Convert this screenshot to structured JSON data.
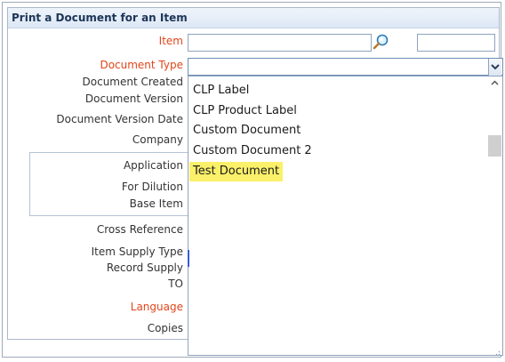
{
  "panel": {
    "title": "Print a Document for an Item"
  },
  "labels": {
    "item": "Item",
    "document_type": "Document Type",
    "document_created": "Document Created",
    "document_version": "Document Version",
    "document_version_date": "Document Version Date",
    "company": "Company",
    "application": "Application",
    "for_dilution": "For Dilution",
    "base_item": "Base Item",
    "cross_reference": "Cross Reference",
    "item_supply_type": "Item Supply Type",
    "record_supply": "Record Supply",
    "to": "TO",
    "language": "Language",
    "copies": "Copies"
  },
  "fields": {
    "item_value": "",
    "item_desc_value": "",
    "document_type_value": ""
  },
  "dropdown": {
    "options": [
      "CLP Label",
      "CLP Product Label",
      "Custom Document",
      "Custom Document 2",
      "Test Document"
    ],
    "highlighted_option": "Test Document"
  },
  "colors": {
    "required_label": "#e0461b",
    "highlight": "#fbf06a",
    "header_text": "#1d3557"
  },
  "icons": {
    "lookup": "magnifier-icon",
    "combo": "chevron-down-icon"
  }
}
